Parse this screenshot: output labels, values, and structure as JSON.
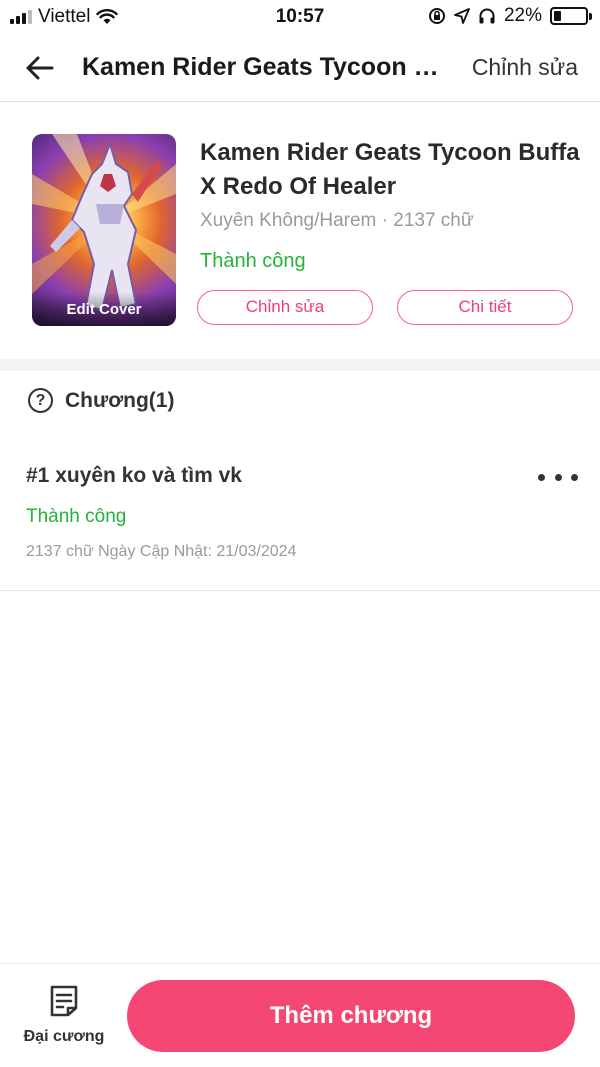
{
  "status_bar": {
    "carrier": "Viettel",
    "time": "10:57",
    "battery_percent": "22%",
    "battery_level": 0.22,
    "icons": [
      "signal-icon",
      "wifi-icon",
      "orientation-lock-icon",
      "location-icon",
      "headphones-icon",
      "battery-icon"
    ]
  },
  "nav": {
    "title": "Kamen Rider Geats Tycoon Buffa X Redo Of Healer",
    "edit_label": "Chỉnh sửa"
  },
  "book": {
    "edit_cover_label": "Edit Cover",
    "title": "Kamen Rider Geats Tycoon Buffa X Redo Of Healer",
    "meta": "Xuyên Không/Harem · 2137 chữ",
    "status": "Thành công",
    "edit_button": "Chỉnh sửa",
    "detail_button": "Chi tiết"
  },
  "chapters": {
    "header": "Chương(1)",
    "items": [
      {
        "title": "#1 xuyên ko và tìm vk",
        "status": "Thành công",
        "meta": "2137 chữ Ngày Cập Nhật: 21/03/2024"
      }
    ]
  },
  "bottom": {
    "outline_label": "Đại cương",
    "add_chapter_label": "Thêm chương"
  },
  "colors": {
    "accent": "#f54773",
    "success": "#23b33a",
    "pill_text": "#f0406e"
  }
}
